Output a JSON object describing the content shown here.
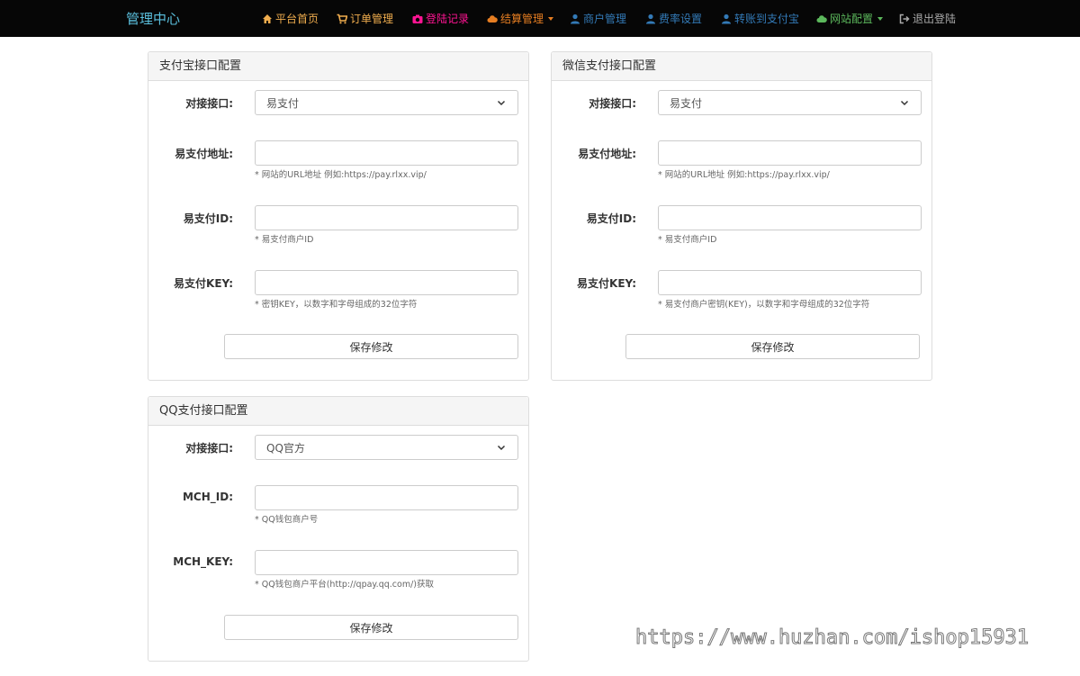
{
  "nav": {
    "brand": "管理中心",
    "items": [
      {
        "label": "平台首页",
        "icon": "home-icon",
        "color": "#f0ad4e"
      },
      {
        "label": "订单管理",
        "icon": "cart-icon",
        "color": "#f0ad4e"
      },
      {
        "label": "登陆记录",
        "icon": "camera-icon",
        "color": "#ff1493"
      },
      {
        "label": "结算管理",
        "icon": "cloud-icon",
        "color": "#e67e22"
      },
      {
        "label": "商户管理",
        "icon": "user-icon",
        "color": "#337ab7"
      },
      {
        "label": "费率设置",
        "icon": "user-icon",
        "color": "#337ab7"
      },
      {
        "label": "转账到支付宝",
        "icon": "user-icon",
        "color": "#337ab7"
      },
      {
        "label": "网站配置",
        "icon": "cloud-icon",
        "color": "#5cb85c"
      },
      {
        "label": "退出登陆",
        "icon": "logout-icon",
        "color": "#aaaaaa"
      }
    ]
  },
  "alipay": {
    "title": "支付宝接口配置",
    "interface_label": "对接接口:",
    "interface_value": "易支付",
    "url_label": "易支付地址:",
    "url_value": "",
    "url_help": "* 网站的URL地址 例如:https://pay.rlxx.vip/",
    "id_label": "易支付ID:",
    "id_value": "",
    "id_help": "* 易支付商户ID",
    "key_label": "易支付KEY:",
    "key_value": "",
    "key_help": "* 密钥KEY，以数字和字母组成的32位字符",
    "save_label": "保存修改"
  },
  "wechat": {
    "title": "微信支付接口配置",
    "interface_label": "对接接口:",
    "interface_value": "易支付",
    "url_label": "易支付地址:",
    "url_value": "",
    "url_help": "* 网站的URL地址 例如:https://pay.rlxx.vip/",
    "id_label": "易支付ID:",
    "id_value": "",
    "id_help": "* 易支付商户ID",
    "key_label": "易支付KEY:",
    "key_value": "",
    "key_help": "* 易支付商户密钥(KEY)，以数字和字母组成的32位字符",
    "save_label": "保存修改"
  },
  "qq": {
    "title": "QQ支付接口配置",
    "interface_label": "对接接口:",
    "interface_value": "QQ官方",
    "mchid_label": "MCH_ID:",
    "mchid_value": "",
    "mchid_help": "* QQ钱包商户号",
    "mchkey_label": "MCH_KEY:",
    "mchkey_value": "",
    "mchkey_help": "* QQ钱包商户平台(http://qpay.qq.com/)获取",
    "save_label": "保存修改"
  },
  "watermark": "https://www.huzhan.com/ishop15931"
}
